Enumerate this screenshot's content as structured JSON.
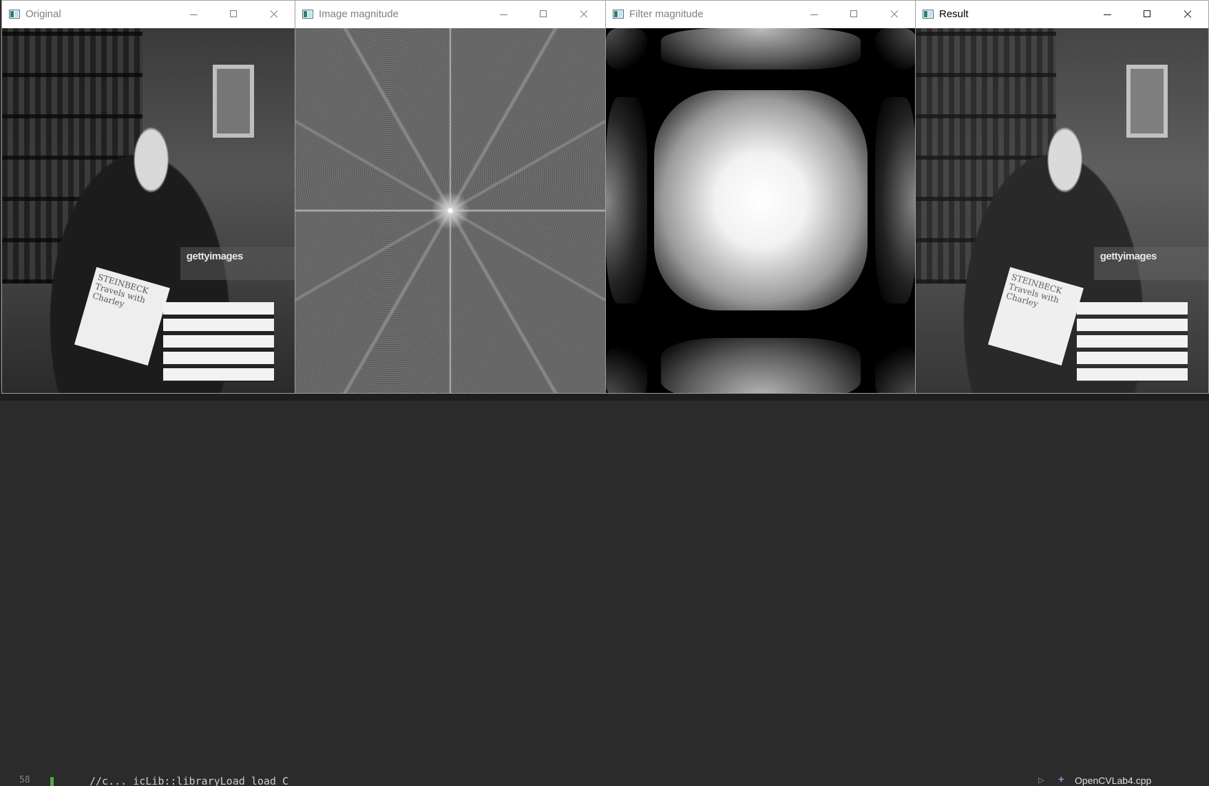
{
  "windows": [
    {
      "id": "original",
      "title": "Original",
      "active": false
    },
    {
      "id": "image-magnitude",
      "title": "Image magnitude",
      "active": false
    },
    {
      "id": "filter-magnitude",
      "title": "Filter magnitude",
      "active": false
    },
    {
      "id": "result",
      "title": "Result",
      "active": true
    }
  ],
  "photo": {
    "book_text": "STEINBECK Travels with Charley",
    "watermark": "gettyimages"
  },
  "editor": {
    "line_number": "58",
    "code_fragment": "//c... icLib::libraryLoad load C",
    "tab_file": "OpenCVLab4.cpp"
  }
}
